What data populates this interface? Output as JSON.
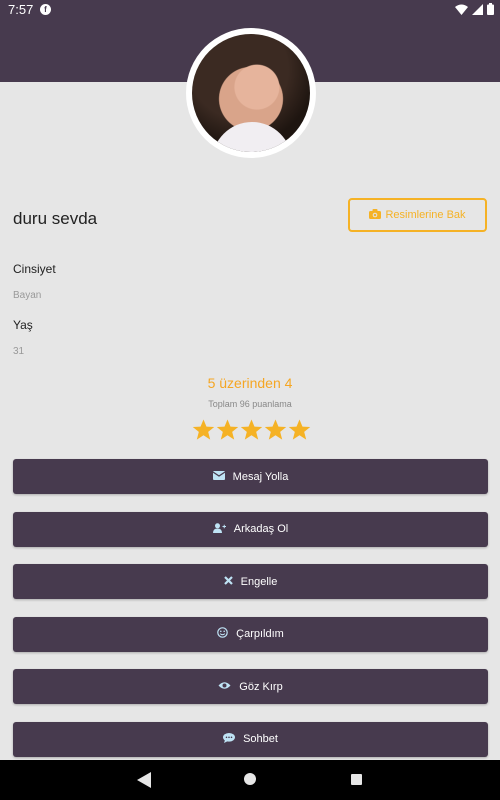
{
  "status_bar": {
    "time": "7:57",
    "notification_icon": "flipboard-icon"
  },
  "profile": {
    "name": "duru sevda",
    "photos_button_label": "Resimlerine Bak",
    "fields": [
      {
        "label": "Cinsiyet",
        "value": "Bayan"
      },
      {
        "label": "Yaş",
        "value": "31"
      }
    ]
  },
  "rating": {
    "title": "5 üzerinden 4",
    "count_text": "Toplam 96 puanlama",
    "stars_filled": 5,
    "stars_total": 5,
    "star_color": "#f5b225"
  },
  "actions": [
    {
      "label": "Mesaj Yolla",
      "icon": "envelope-icon"
    },
    {
      "label": "Arkadaş Ol",
      "icon": "add-user-icon"
    },
    {
      "label": "Engelle",
      "icon": "close-icon"
    },
    {
      "label": "Çarpıldım",
      "icon": "smile-icon"
    },
    {
      "label": "Göz Kırp",
      "icon": "eye-icon"
    },
    {
      "label": "Sohbet",
      "icon": "chat-icon"
    }
  ],
  "colors": {
    "primary": "#473a4e",
    "accent": "#f5b225",
    "background": "#e6e6e6"
  }
}
